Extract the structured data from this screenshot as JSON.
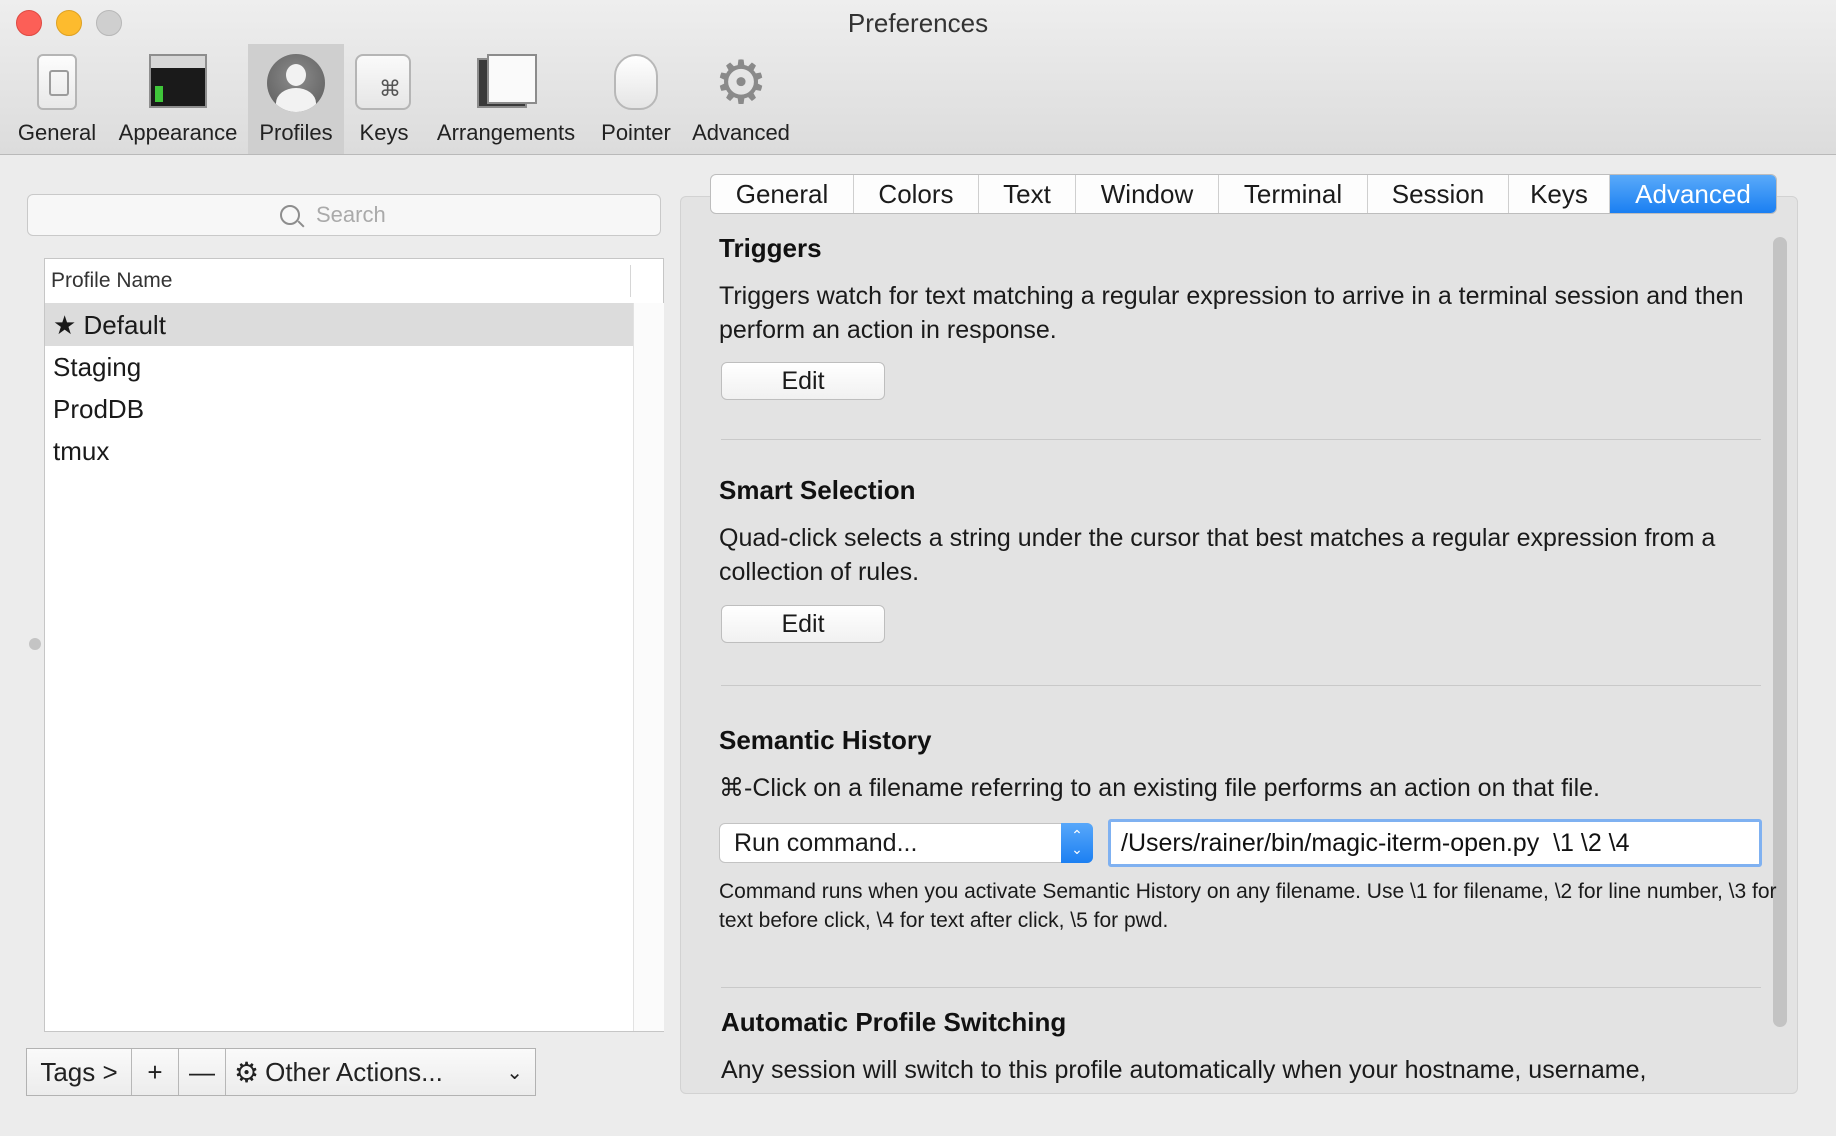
{
  "window": {
    "title": "Preferences"
  },
  "toolbar": {
    "items": [
      {
        "label": "General",
        "icon": "general-switch-icon"
      },
      {
        "label": "Appearance",
        "icon": "appearance-terminal-icon"
      },
      {
        "label": "Profiles",
        "icon": "profiles-avatar-icon",
        "active": true
      },
      {
        "label": "Keys",
        "icon": "keys-command-icon",
        "glyph": "⌘"
      },
      {
        "label": "Arrangements",
        "icon": "arrangements-windows-icon"
      },
      {
        "label": "Pointer",
        "icon": "pointer-mouse-icon"
      },
      {
        "label": "Advanced",
        "icon": "advanced-gear-icon",
        "glyph": "⚙"
      }
    ]
  },
  "sidebar": {
    "search": {
      "placeholder": "Search"
    },
    "table": {
      "header": "Profile Name",
      "rows": [
        {
          "name": "★ Default",
          "selected": true
        },
        {
          "name": "Staging"
        },
        {
          "name": "ProdDB"
        },
        {
          "name": "tmux"
        }
      ]
    },
    "bottom_bar": {
      "tags": "Tags >",
      "add": "+",
      "remove": "—",
      "actions": "Other Actions...",
      "actions_gear": "⚙",
      "actions_chevron": "⌄"
    }
  },
  "tabs": {
    "items": [
      "General",
      "Colors",
      "Text",
      "Window",
      "Terminal",
      "Session",
      "Keys",
      "Advanced"
    ],
    "active": "Advanced"
  },
  "sections": {
    "triggers": {
      "title": "Triggers",
      "description": "Triggers watch for text matching a regular expression to arrive in a terminal session and then perform an action in response.",
      "button": "Edit"
    },
    "smart_selection": {
      "title": "Smart Selection",
      "description": "Quad-click selects a string under the cursor that best matches a regular expression from a collection of rules.",
      "button": "Edit"
    },
    "semantic_history": {
      "title": "Semantic History",
      "description": "⌘-Click on a filename referring to an existing file performs an action on that file.",
      "action_select": "Run command...",
      "command_value": "/Users/rainer/bin/magic-iterm-open.py  \\1 \\2 \\4",
      "help": "Command runs when you activate Semantic History on any filename. Use \\1 for filename, \\2 for line number, \\3 for text before click, \\4 for text after click, \\5 for pwd."
    },
    "auto_switching": {
      "title": "Automatic Profile Switching",
      "description": "Any session will switch to this profile automatically when your hostname, username,"
    }
  },
  "colors": {
    "accent": "#1a7ff2",
    "close": "#fc5f57",
    "minimize": "#fdbb2e",
    "maximize": "#cfcfcf"
  }
}
